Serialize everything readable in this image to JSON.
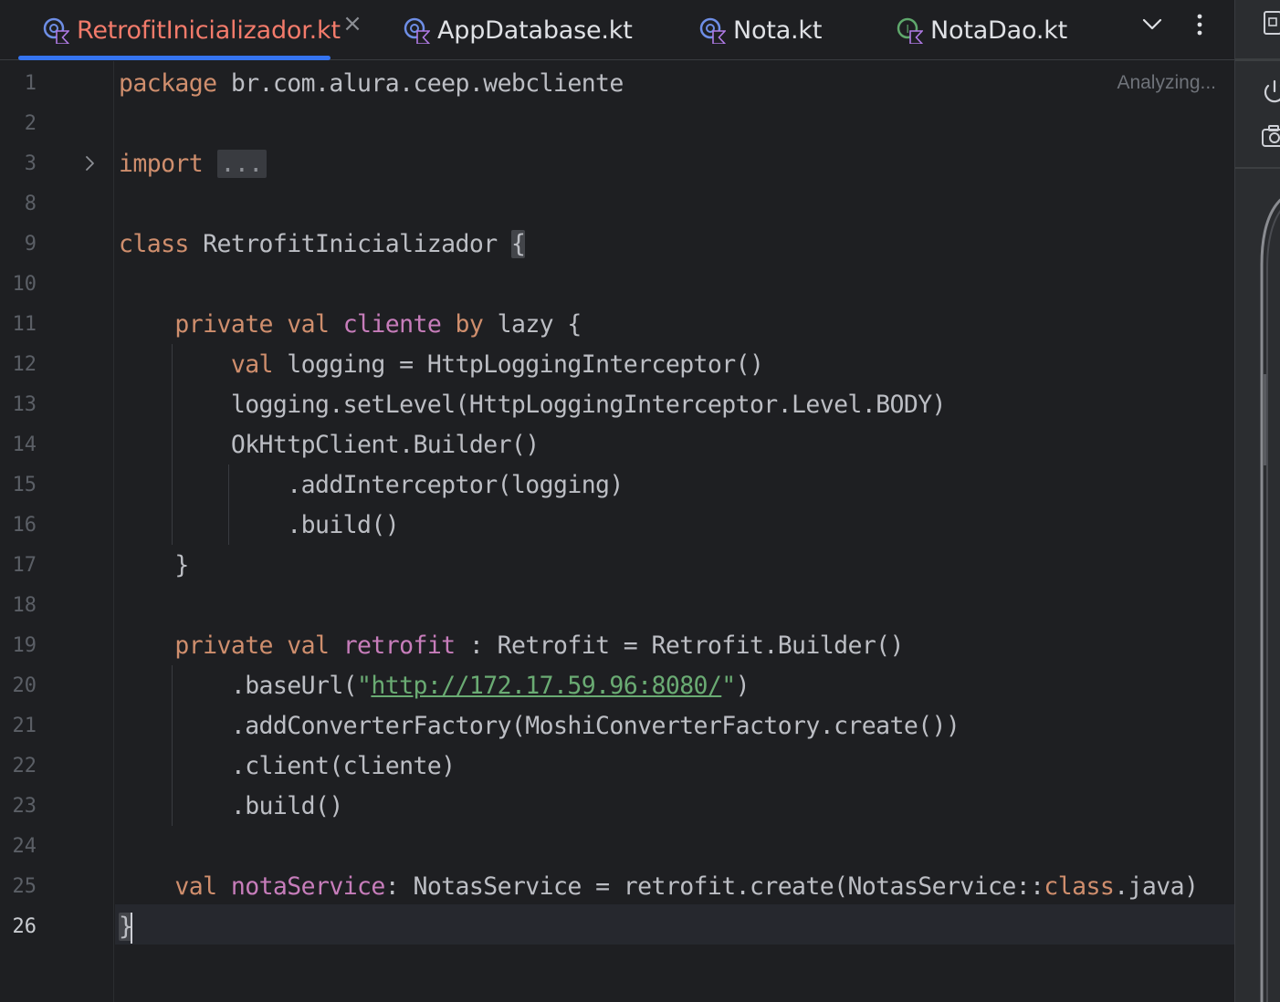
{
  "tabs": [
    {
      "name": "RetrofitInicializador.kt",
      "active": true
    },
    {
      "name": "AppDatabase.kt",
      "active": false
    },
    {
      "name": "Nota.kt",
      "active": false
    },
    {
      "name": "NotaDao.kt",
      "active": false
    }
  ],
  "tab_close_glyph": "×",
  "status": "Analyzing...",
  "line_numbers": [
    "1",
    "2",
    "3",
    "8",
    "9",
    "10",
    "11",
    "12",
    "13",
    "14",
    "15",
    "16",
    "17",
    "18",
    "19",
    "20",
    "21",
    "22",
    "23",
    "24",
    "25",
    "26"
  ],
  "current_line": "26",
  "code": {
    "l1": {
      "kw": "package",
      "rest": " br.com.alura.ceep.webcliente"
    },
    "l3": {
      "kw": "import",
      "folded": "..."
    },
    "l9": {
      "kw": "class",
      "name": " RetrofitInicializador ",
      "brace": "{"
    },
    "l11": {
      "kw1": "private",
      "kw2": "val",
      "prop": "cliente",
      "kw3": "by",
      "rest": " lazy {"
    },
    "l12": {
      "kw": "val",
      "rest": " logging = HttpLoggingInterceptor()"
    },
    "l13": "logging.setLevel(HttpLoggingInterceptor.Level.BODY)",
    "l14": "OkHttpClient.Builder()",
    "l15": ".addInterceptor(logging)",
    "l16": ".build()",
    "l17": "}",
    "l19": {
      "kw1": "private",
      "kw2": "val",
      "prop": "retrofit",
      "rest": " : Retrofit = Retrofit.Builder()"
    },
    "l20": {
      "pre": ".baseUrl(",
      "q1": "\"",
      "url": "http://172.17.59.96:8080/",
      "q2": "\"",
      "post": ")"
    },
    "l21": ".addConverterFactory(MoshiConverterFactory.create())",
    "l22": ".client(cliente)",
    "l23": ".build()",
    "l25": {
      "kw": "val",
      "prop": "notaService",
      "mid": ": NotasService = retrofit.create(NotasService::",
      "kw2": "class",
      "post": ".java)"
    },
    "l26": "}"
  },
  "colors": {
    "keyword": "#cf8e6d",
    "property": "#c77dbb",
    "string": "#6aab73",
    "text": "#bcbec4",
    "background": "#1e1f22",
    "active_tab": "#f37b6b",
    "tab_underline": "#3574f0"
  },
  "icons": [
    "kotlin-file-icon",
    "kotlin-interface-icon",
    "close-icon",
    "chevron-down-icon",
    "more-vertical-icon",
    "power-icon",
    "camera-icon",
    "device-manager-icon",
    "fold-arrow-icon"
  ]
}
